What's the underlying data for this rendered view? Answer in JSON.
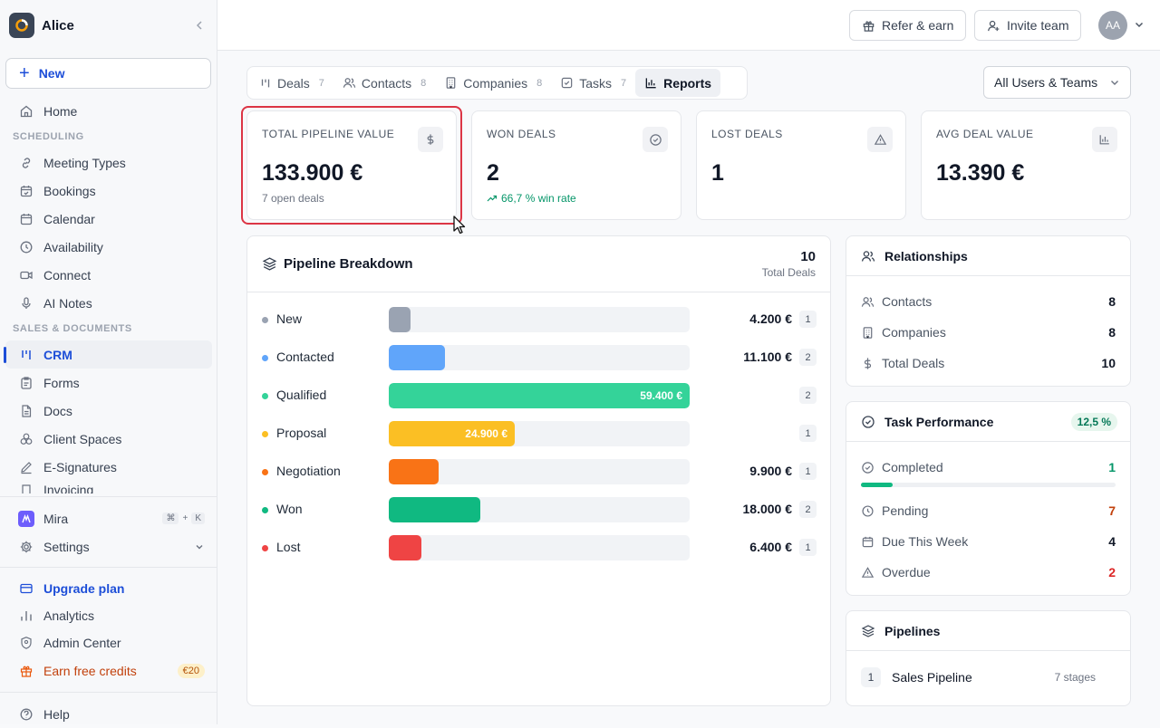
{
  "workspace": {
    "name": "Alice"
  },
  "sidebar": {
    "new_label": "New",
    "home": "Home",
    "scheduling_title": "SCHEDULING",
    "scheduling": [
      "Meeting Types",
      "Bookings",
      "Calendar",
      "Availability",
      "Connect",
      "AI Notes"
    ],
    "sales_title": "SALES & DOCUMENTS",
    "sales": [
      "CRM",
      "Forms",
      "Docs",
      "Client Spaces",
      "E-Signatures",
      "Invoicing"
    ],
    "mira": "Mira",
    "shortcut": [
      "⌘",
      "+",
      "K"
    ],
    "settings": "Settings",
    "upgrade": "Upgrade plan",
    "analytics": "Analytics",
    "admin": "Admin Center",
    "earn": "Earn free credits",
    "earn_badge": "€20",
    "help": "Help"
  },
  "topbar": {
    "refer": "Refer & earn",
    "invite": "Invite team",
    "avatar": "AA"
  },
  "tabs": [
    {
      "label": "Deals",
      "count": "7",
      "icon": "kanban-icon"
    },
    {
      "label": "Contacts",
      "count": "8",
      "icon": "users-icon"
    },
    {
      "label": "Companies",
      "count": "8",
      "icon": "building-icon"
    },
    {
      "label": "Tasks",
      "count": "7",
      "icon": "check-square-icon"
    },
    {
      "label": "Reports",
      "count": "",
      "icon": "bar-chart-icon"
    }
  ],
  "filter": {
    "value": "All Users & Teams"
  },
  "stats": [
    {
      "label": "TOTAL PIPELINE VALUE",
      "value": "133.900 €",
      "sub": "7 open deals"
    },
    {
      "label": "WON DEALS",
      "value": "2",
      "sub": "66,7 % win rate"
    },
    {
      "label": "LOST DEALS",
      "value": "1",
      "sub": ""
    },
    {
      "label": "AVG DEAL VALUE",
      "value": "13.390 €",
      "sub": ""
    }
  ],
  "pipeline": {
    "title": "Pipeline Breakdown",
    "total": "10",
    "total_label": "Total Deals",
    "stages": [
      {
        "name": "New",
        "amount": "4.200 €",
        "count": "1",
        "color": "#9aa3b2",
        "fill": 0.071
      },
      {
        "name": "Contacted",
        "amount": "11.100 €",
        "count": "2",
        "color": "#60a5fa",
        "fill": 0.187
      },
      {
        "name": "Qualified",
        "amount": "59.400 €",
        "count": "2",
        "color": "#34d399",
        "fill": 1.0
      },
      {
        "name": "Proposal",
        "amount": "24.900 €",
        "count": "1",
        "color": "#fbbf24",
        "fill": 0.419
      },
      {
        "name": "Negotiation",
        "amount": "9.900 €",
        "count": "1",
        "color": "#f97316",
        "fill": 0.167
      },
      {
        "name": "Won",
        "amount": "18.000 €",
        "count": "2",
        "color": "#10b981",
        "fill": 0.303
      },
      {
        "name": "Lost",
        "amount": "6.400 €",
        "count": "1",
        "color": "#ef4444",
        "fill": 0.108
      }
    ]
  },
  "relationships": {
    "title": "Relationships",
    "rows": [
      {
        "label": "Contacts",
        "value": "8"
      },
      {
        "label": "Companies",
        "value": "8"
      },
      {
        "label": "Total Deals",
        "value": "10"
      }
    ]
  },
  "tasks": {
    "title": "Task Performance",
    "badge": "12,5 %",
    "completed": {
      "label": "Completed",
      "value": "1",
      "color": "#059669"
    },
    "progress": 0.125,
    "pending": {
      "label": "Pending",
      "value": "7",
      "color": "#c2410c"
    },
    "due": {
      "label": "Due This Week",
      "value": "4",
      "color": "#111827"
    },
    "overdue": {
      "label": "Overdue",
      "value": "2",
      "color": "#dc2626"
    }
  },
  "pipelines": {
    "title": "Pipelines",
    "items": [
      {
        "num": "1",
        "name": "Sales Pipeline",
        "stages": "7 stages"
      }
    ]
  }
}
